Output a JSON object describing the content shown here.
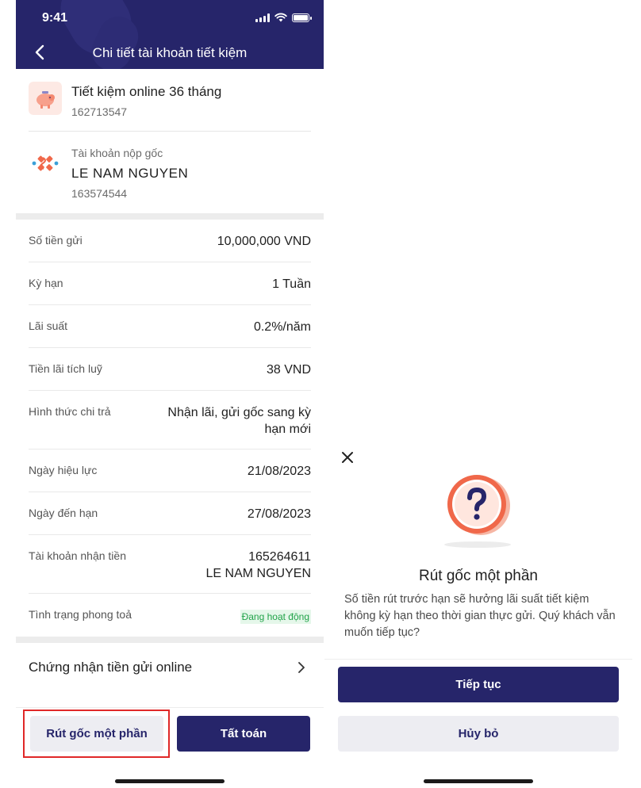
{
  "status_bar": {
    "time": "9:41"
  },
  "header": {
    "title": "Chi tiết tài khoản tiết kiệm"
  },
  "savings_account": {
    "name": "Tiết kiệm online 36 tháng",
    "number": "162713547"
  },
  "source_account": {
    "label": "Tài khoản nộp gốc",
    "name": "LE NAM NGUYEN",
    "number": "163574544"
  },
  "details": [
    {
      "label": "Số tiền gửi",
      "value": "10,000,000 VND"
    },
    {
      "label": "Kỳ hạn",
      "value": "1 Tuần"
    },
    {
      "label": "Lãi suất",
      "value": "0.2%/năm"
    },
    {
      "label": "Tiền lãi tích luỹ",
      "value": "38 VND"
    },
    {
      "label": "Hình thức chi trả",
      "value_line1": "Nhận lãi, gửi gốc sang kỳ",
      "value_line2": "hạn mới"
    },
    {
      "label": "Ngày hiệu lực",
      "value": "21/08/2023"
    },
    {
      "label": "Ngày đến hạn",
      "value": "27/08/2023"
    },
    {
      "label": "Tài khoản nhận tiền",
      "value_line1": "165264611",
      "value_line2": "LE NAM NGUYEN"
    },
    {
      "label": "Tình trạng phong toả",
      "value": "Đang hoạt động"
    }
  ],
  "certificate": {
    "label": "Chứng nhận tiền gửi online"
  },
  "actions": {
    "partial_withdraw": "Rút gốc một phần",
    "settle": "Tất toán"
  },
  "modal": {
    "title": "Rút gốc một phần",
    "description": "Số tiền rút trước hạn sẽ hưởng lãi suất tiết kiệm không kỳ hạn theo thời gian thực gửi. Quý khách vẫn muốn tiếp tục?",
    "confirm": "Tiếp tục",
    "cancel": "Hủy bỏ"
  },
  "colors": {
    "primary": "#26256a",
    "accent_orange": "#f0684a",
    "status_active_green": "#22a34a",
    "highlight_red": "#e02828"
  }
}
